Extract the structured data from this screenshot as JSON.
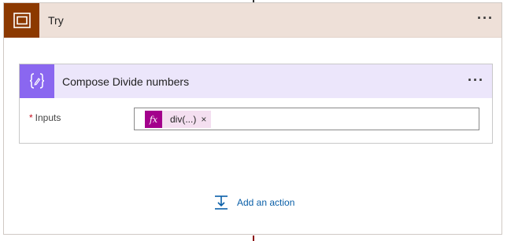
{
  "scope": {
    "title": "Try",
    "menu_glyph": "···",
    "icon": "scope-icon",
    "color": "#8c3900",
    "header_bg": "#eee0d8"
  },
  "action": {
    "title": "Compose Divide numbers",
    "menu_glyph": "···",
    "icon": "compose-icon",
    "color": "#8a67f0",
    "header_bg": "#ece6fb",
    "inputs": {
      "required_mark": "*",
      "label": "Inputs",
      "token": {
        "icon_text": "fx",
        "label": "div(...)",
        "remove_glyph": "×",
        "icon_color": "#a3008c"
      }
    }
  },
  "add_action": {
    "label": "Add an action",
    "icon": "add-action-icon",
    "color": "#0a5fa8"
  }
}
